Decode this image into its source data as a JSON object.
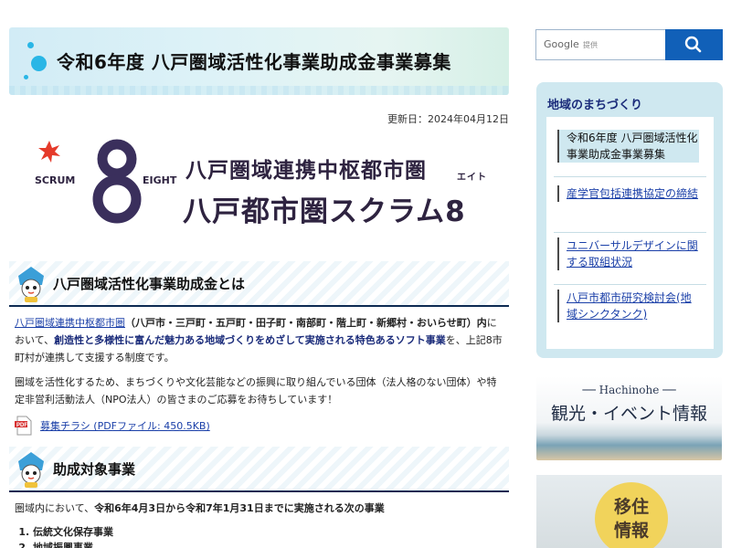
{
  "page": {
    "title": "令和6年度 八戸圏域活性化事業助成金事業募集",
    "updated": "更新日：2024年04月12日"
  },
  "logo": {
    "scrum": "SCRUM",
    "eight": "EIGHT",
    "line1": "八戸圏域連携中枢都市圏",
    "line2": "八戸都市圏スクラム8",
    "ruby": "エイト"
  },
  "section1": {
    "heading": "八戸圏域活性化事業助成金とは",
    "link": "八戸圏域連携中枢都市圏",
    "municipalities": "（八戸市・三戸町・五戸町・田子町・南部町・階上町・新郷村・おいらせ町）内",
    "text_a": "において、",
    "emphasis": "創造性と多様性に富んだ魅力ある地域づくりをめざして実施される特色あるソフト事業",
    "text_b": "を、上記8市町村が連携して支援する制度です。",
    "paragraph2": "圏域を活性化するため、まちづくりや文化芸能などの振興に取り組んでいる団体（法人格のない団体）や特定非営利活動法人（NPO法人）の皆さまのご応募をお待ちしています！",
    "pdf_link": "募集チラシ (PDFファイル: 450.5KB)"
  },
  "section2": {
    "heading": "助成対象事業",
    "intro_a": "圏域内において、",
    "intro_bold": "令和6年4月3日から令和7年1月31日までに実施される次の事業",
    "items": [
      "伝統文化保存事業",
      "地域振興事業"
    ]
  },
  "sidebar": {
    "search_brand": "Google",
    "search_powered": "提供",
    "box_title": "地域のまちづくり",
    "items": [
      {
        "label": "令和6年度 八戸圏域活性化事業助成金事業募集"
      },
      {
        "label": "産学官包括連携協定の締結"
      },
      {
        "label": "ユニバーサルデザインに関する取組状況"
      },
      {
        "label": "八戸市都市研究検討会(地域シンクタンク)"
      }
    ],
    "tour_small": "Hachinohe",
    "tour_big": "観光・イベント情報",
    "ijyu_line1": "移住",
    "ijyu_line2": "情報"
  }
}
